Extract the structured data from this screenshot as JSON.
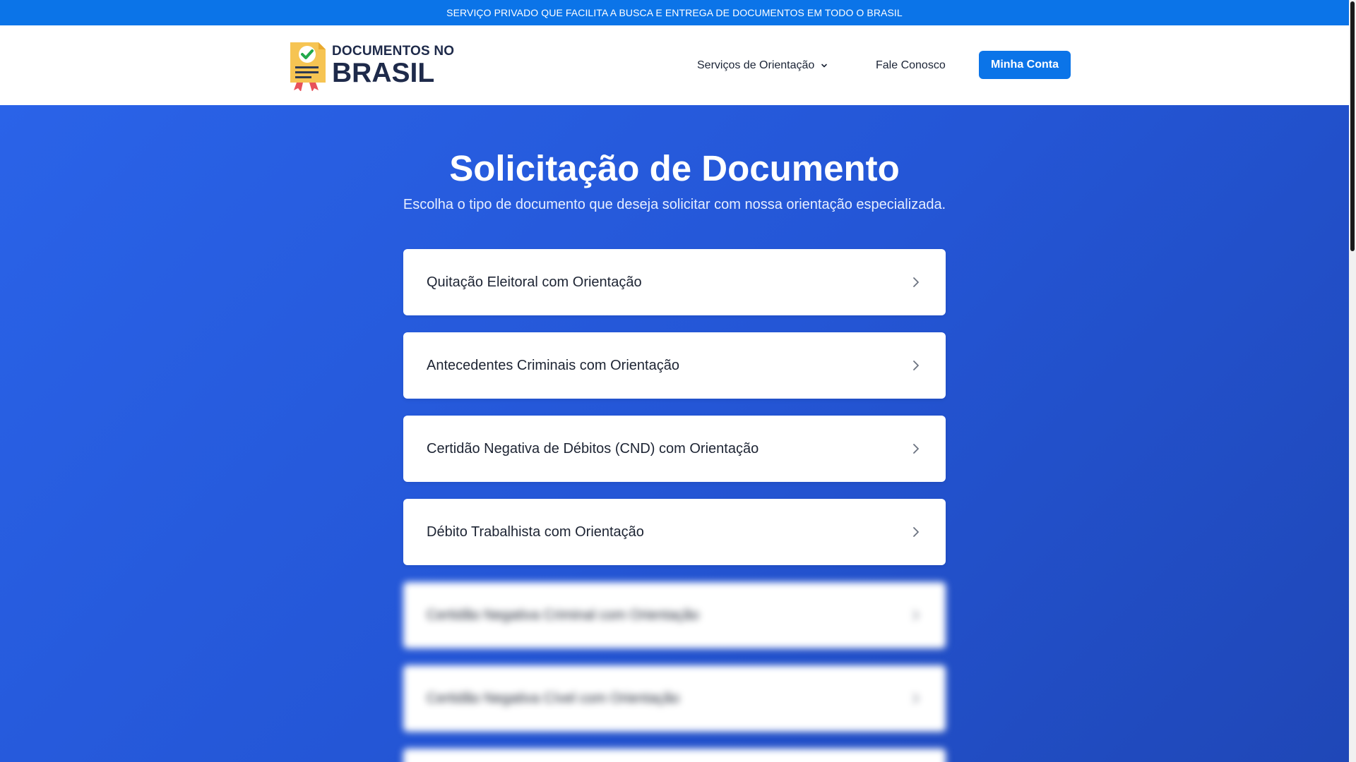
{
  "topbar": {
    "text": "SERVIÇO PRIVADO QUE FACILITA A BUSCA E ENTREGA DE DOCUMENTOS EM TODO O BRASIL"
  },
  "header": {
    "logo_small": "DOCUMENTOS NO",
    "logo_big": "BRASIL",
    "nav": {
      "services": "Serviços de Orientação",
      "contact": "Fale Conosco"
    },
    "account_button": "Minha Conta"
  },
  "hero": {
    "title": "Solicitação de Documento",
    "subtitle": "Escolha o tipo de documento que deseja solicitar com nossa orientação especializada."
  },
  "documents": [
    {
      "label": "Quitação Eleitoral com Orientação"
    },
    {
      "label": "Antecedentes Criminais com Orientação"
    },
    {
      "label": "Certidão Negativa de Débitos (CND) com Orientação"
    },
    {
      "label": "Débito Trabalhista com Orientação"
    },
    {
      "label": "Certidão Negativa Criminal com Orientação"
    },
    {
      "label": "Certidão Negativa Cível com Orientação"
    }
  ],
  "icons": {
    "services_caret": "chevron-down-icon",
    "card_arrow": "chevron-right-icon",
    "logo": "certificate-check-icon"
  },
  "colors": {
    "primary": "#0b74e8",
    "hero_bg": "#2458d8",
    "text_dark": "#1d2433"
  }
}
